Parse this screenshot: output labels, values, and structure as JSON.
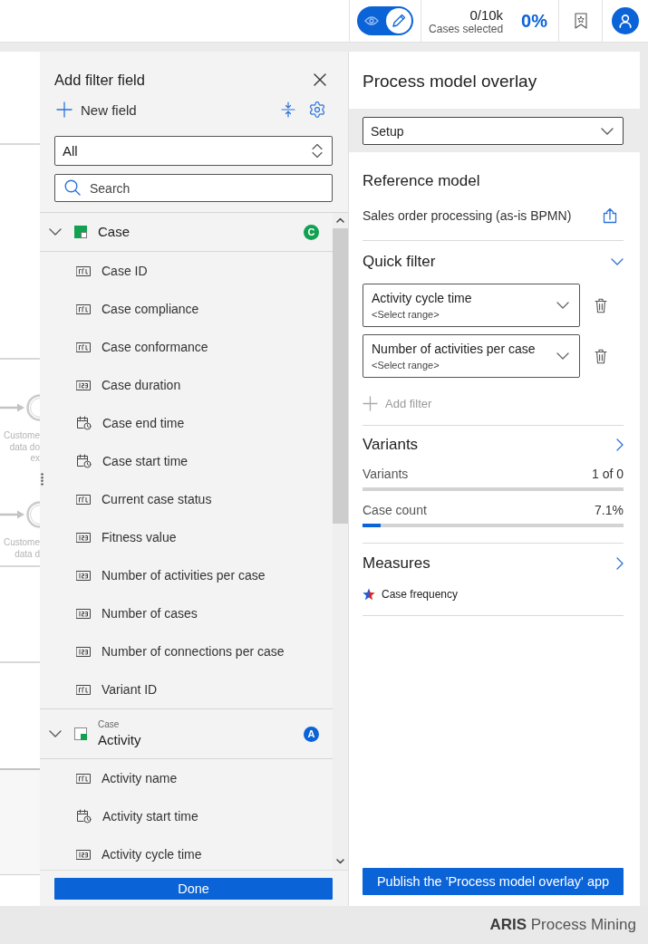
{
  "toolbar": {
    "modes": [
      {
        "kind": "view",
        "selected": false
      },
      {
        "kind": "edit",
        "selected": true
      }
    ],
    "selection_count": "0/10k",
    "selection_label": "Cases selected",
    "selection_percent": "0%"
  },
  "canvas": {
    "nodes": [
      {
        "label_lines": [
          "Custome",
          "data do",
          "ex"
        ]
      },
      {
        "label_lines": [
          "Custome",
          "data d"
        ]
      }
    ]
  },
  "filter_panel": {
    "title": "Add filter field",
    "new_field": "New field",
    "category": {
      "value": "All"
    },
    "search": {
      "placeholder": "Search"
    },
    "groups": [
      {
        "kind": "case",
        "name": "Case",
        "badge": "C",
        "color": "#12a150",
        "expanded": true,
        "fields": [
          {
            "kind": "text",
            "name": "Case ID"
          },
          {
            "kind": "text",
            "name": "Case compliance"
          },
          {
            "kind": "text",
            "name": "Case conformance"
          },
          {
            "kind": "number",
            "name": "Case duration"
          },
          {
            "kind": "datetime",
            "name": "Case end time"
          },
          {
            "kind": "datetime",
            "name": "Case start time"
          },
          {
            "kind": "text",
            "name": "Current case status"
          },
          {
            "kind": "number",
            "name": "Fitness value"
          },
          {
            "kind": "number",
            "name": "Number of activities per case"
          },
          {
            "kind": "number",
            "name": "Number of cases"
          },
          {
            "kind": "number",
            "name": "Number of connections per case"
          },
          {
            "kind": "text",
            "name": "Variant ID"
          }
        ]
      },
      {
        "kind": "activity",
        "parent": "Case",
        "name": "Activity",
        "badge": "A",
        "color": "#0b63d8",
        "expanded": true,
        "fields": [
          {
            "kind": "text",
            "name": "Activity name"
          },
          {
            "kind": "datetime",
            "name": "Activity start time"
          },
          {
            "kind": "number",
            "name": "Activity cycle time"
          }
        ]
      }
    ],
    "done": "Done"
  },
  "overlay_panel": {
    "title": "Process model overlay",
    "mode": {
      "value": "Setup"
    },
    "reference_model": {
      "title": "Reference model",
      "name": "Sales order processing (as-is BPMN)"
    },
    "quick_filter": {
      "title": "Quick filter",
      "expanded": true,
      "filters": [
        {
          "name": "Activity cycle time",
          "range": "<Select range>"
        },
        {
          "name": "Number of activities per case",
          "range": "<Select range>"
        }
      ],
      "add_filter": {
        "label": "Add filter",
        "disabled": true
      }
    },
    "variants": {
      "title": "Variants",
      "meters": [
        {
          "label": "Variants",
          "reading": "1 of 0"
        },
        {
          "label": "Case count",
          "reading": "7.1%",
          "level": 0.071
        }
      ]
    },
    "measures": {
      "title": "Measures",
      "items": [
        {
          "name": "Case frequency"
        }
      ]
    },
    "publish": "Publish the 'Process model overlay' app"
  },
  "footer": {
    "brand": "**ARIS** Process Mining"
  }
}
